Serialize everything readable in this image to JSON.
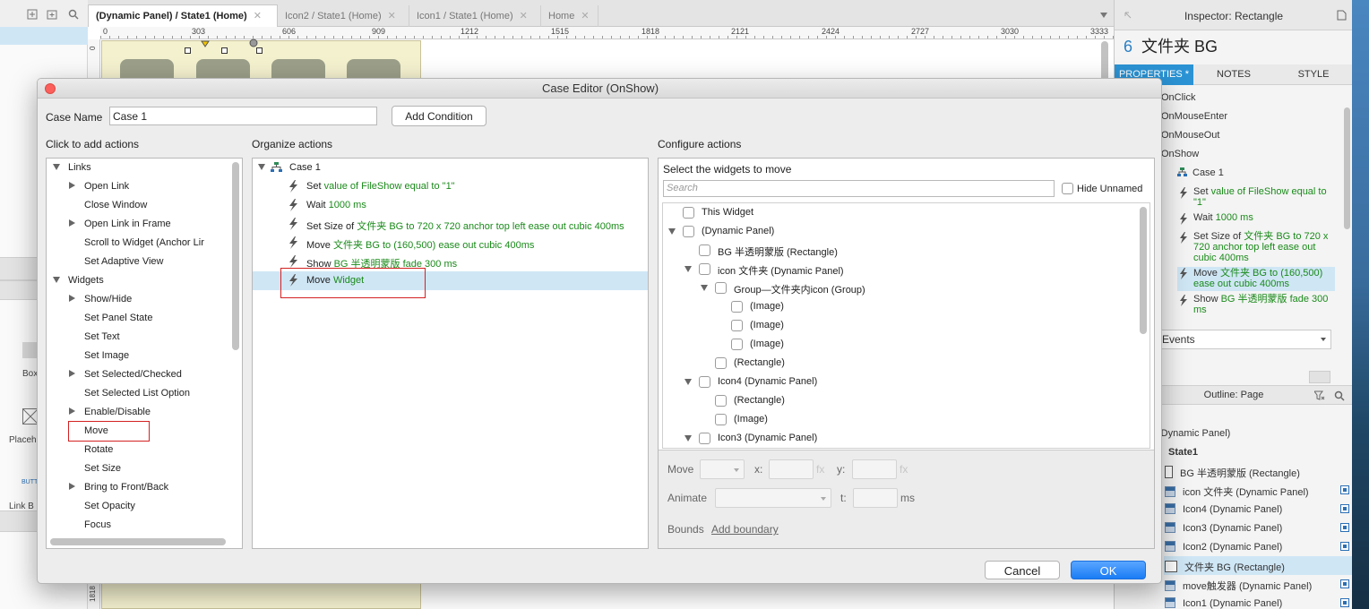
{
  "tabs": [
    {
      "label": "(Dynamic Panel) / State1 (Home)",
      "active": true
    },
    {
      "label": "Icon2 / State1 (Home)"
    },
    {
      "label": "Icon1 / State1 (Home)"
    },
    {
      "label": "Home"
    }
  ],
  "ruler_ticks": [
    "0",
    "303",
    "606",
    "909",
    "1212",
    "1515",
    "1818",
    "2121",
    "2424",
    "2727",
    "3030",
    "3333"
  ],
  "ruler_v": [
    "0",
    "1818"
  ],
  "left_panel": {
    "box_label": "Box",
    "placeholder_label": "Placeh",
    "link_label": "Link B",
    "button_label": "BUTT"
  },
  "inspector": {
    "header": "Inspector: Rectangle",
    "count": "6",
    "name": "文件夹 BG",
    "tabs": [
      "PROPERTIES *",
      "NOTES",
      "STYLE"
    ],
    "events": [
      "OnClick",
      "OnMouseEnter",
      "OnMouseOut",
      "OnShow"
    ],
    "case": "Case 1",
    "actions": [
      {
        "prefix": "Set ",
        "detail": "value of FileShow equal to \"1\""
      },
      {
        "prefix": "Wait ",
        "detail": "1000 ms"
      },
      {
        "prefix": "Set Size of ",
        "detail": "文件夹 BG to 720 x 720 anchor top left ease out cubic 400ms"
      },
      {
        "prefix": "Move ",
        "detail": "文件夹 BG to (160,500) ease out cubic 400ms"
      },
      {
        "prefix": "Show ",
        "detail": "BG 半透明蒙版 fade 300 ms"
      }
    ],
    "dropdown": "Events"
  },
  "outline": {
    "header": "Outline: Page",
    "rows": [
      {
        "label": "(Dynamic Panel)"
      },
      {
        "label": "State1",
        "bold": true
      },
      {
        "label": "BG 半透明蒙版 (Rectangle)",
        "icon": "rect"
      },
      {
        "label": "icon 文件夹 (Dynamic Panel)",
        "icon": "dp"
      },
      {
        "label": "Icon4 (Dynamic Panel)",
        "icon": "dp"
      },
      {
        "label": "Icon3 (Dynamic Panel)",
        "icon": "dp"
      },
      {
        "label": "Icon2 (Dynamic Panel)",
        "icon": "dp"
      },
      {
        "label": "文件夹 BG (Rectangle)",
        "icon": "rect",
        "selected": true
      },
      {
        "label": "move触发器 (Dynamic Panel)",
        "icon": "dp"
      },
      {
        "label": "Icon1 (Dynamic Panel)",
        "icon": "dp"
      }
    ]
  },
  "dialog": {
    "title": "Case Editor (OnShow)",
    "case_name_label": "Case Name",
    "case_name_value": "Case 1",
    "add_condition": "Add Condition",
    "col1_title": "Click to add actions",
    "col2_title": "Organize actions",
    "col3_title": "Configure actions",
    "action_tree": [
      {
        "label": "Links",
        "level": 0,
        "toggle": "down"
      },
      {
        "label": "Open Link",
        "level": 1,
        "toggle": "right"
      },
      {
        "label": "Close Window",
        "level": 1
      },
      {
        "label": "Open Link in Frame",
        "level": 1,
        "toggle": "right"
      },
      {
        "label": "Scroll to Widget (Anchor Lir",
        "level": 1
      },
      {
        "label": "Set Adaptive View",
        "level": 1
      },
      {
        "label": "Widgets",
        "level": 0,
        "toggle": "down"
      },
      {
        "label": "Show/Hide",
        "level": 1,
        "toggle": "right"
      },
      {
        "label": "Set Panel State",
        "level": 1
      },
      {
        "label": "Set Text",
        "level": 1
      },
      {
        "label": "Set Image",
        "level": 1
      },
      {
        "label": "Set Selected/Checked",
        "level": 1,
        "toggle": "right"
      },
      {
        "label": "Set Selected List Option",
        "level": 1
      },
      {
        "label": "Enable/Disable",
        "level": 1,
        "toggle": "right"
      },
      {
        "label": "Move",
        "level": 1,
        "boxed": true
      },
      {
        "label": "Rotate",
        "level": 1
      },
      {
        "label": "Set Size",
        "level": 1
      },
      {
        "label": "Bring to Front/Back",
        "level": 1,
        "toggle": "right"
      },
      {
        "label": "Set Opacity",
        "level": 1
      },
      {
        "label": "Focus",
        "level": 1
      }
    ],
    "organize": {
      "case": "Case 1",
      "actions": [
        {
          "prefix": "Set ",
          "detail": "value of FileShow equal to \"1\""
        },
        {
          "prefix": "Wait ",
          "detail": "1000 ms"
        },
        {
          "prefix": "Set Size of ",
          "detail": "文件夹 BG to 720 x 720 anchor top left ease out cubic 400ms"
        },
        {
          "prefix": "Move ",
          "detail": "文件夹 BG to (160,500) ease out cubic 400ms"
        },
        {
          "prefix": "Show ",
          "detail": "BG 半透明蒙版 fade 300 ms"
        },
        {
          "prefix": "Move ",
          "detail": "Widget",
          "selected": true
        }
      ]
    },
    "configure": {
      "heading": "Select the widgets to move",
      "search_placeholder": "Search",
      "hide_unnamed": "Hide Unnamed",
      "widgets": [
        {
          "label": "This Widget",
          "level": 0
        },
        {
          "label": "(Dynamic Panel)",
          "level": 0,
          "toggle": true
        },
        {
          "label": "BG 半透明蒙版 (Rectangle)",
          "level": 1
        },
        {
          "label": "icon 文件夹 (Dynamic Panel)",
          "level": 1,
          "toggle": true
        },
        {
          "label": "Group—文件夹内icon (Group)",
          "level": 2,
          "toggle": true
        },
        {
          "label": "(Image)",
          "level": 3
        },
        {
          "label": "(Image)",
          "level": 3
        },
        {
          "label": "(Image)",
          "level": 3
        },
        {
          "label": "(Rectangle)",
          "level": 2
        },
        {
          "label": "Icon4 (Dynamic Panel)",
          "level": 1,
          "toggle": true
        },
        {
          "label": "(Rectangle)",
          "level": 2
        },
        {
          "label": "(Image)",
          "level": 2
        },
        {
          "label": "Icon3 (Dynamic Panel)",
          "level": 1,
          "toggle": true
        }
      ],
      "move_label": "Move",
      "x_label": "x:",
      "y_label": "y:",
      "fx": "fx",
      "animate_label": "Animate",
      "t_label": "t:",
      "ms_label": "ms",
      "bounds_label": "Bounds",
      "add_boundary": "Add boundary"
    },
    "cancel": "Cancel",
    "ok": "OK"
  }
}
